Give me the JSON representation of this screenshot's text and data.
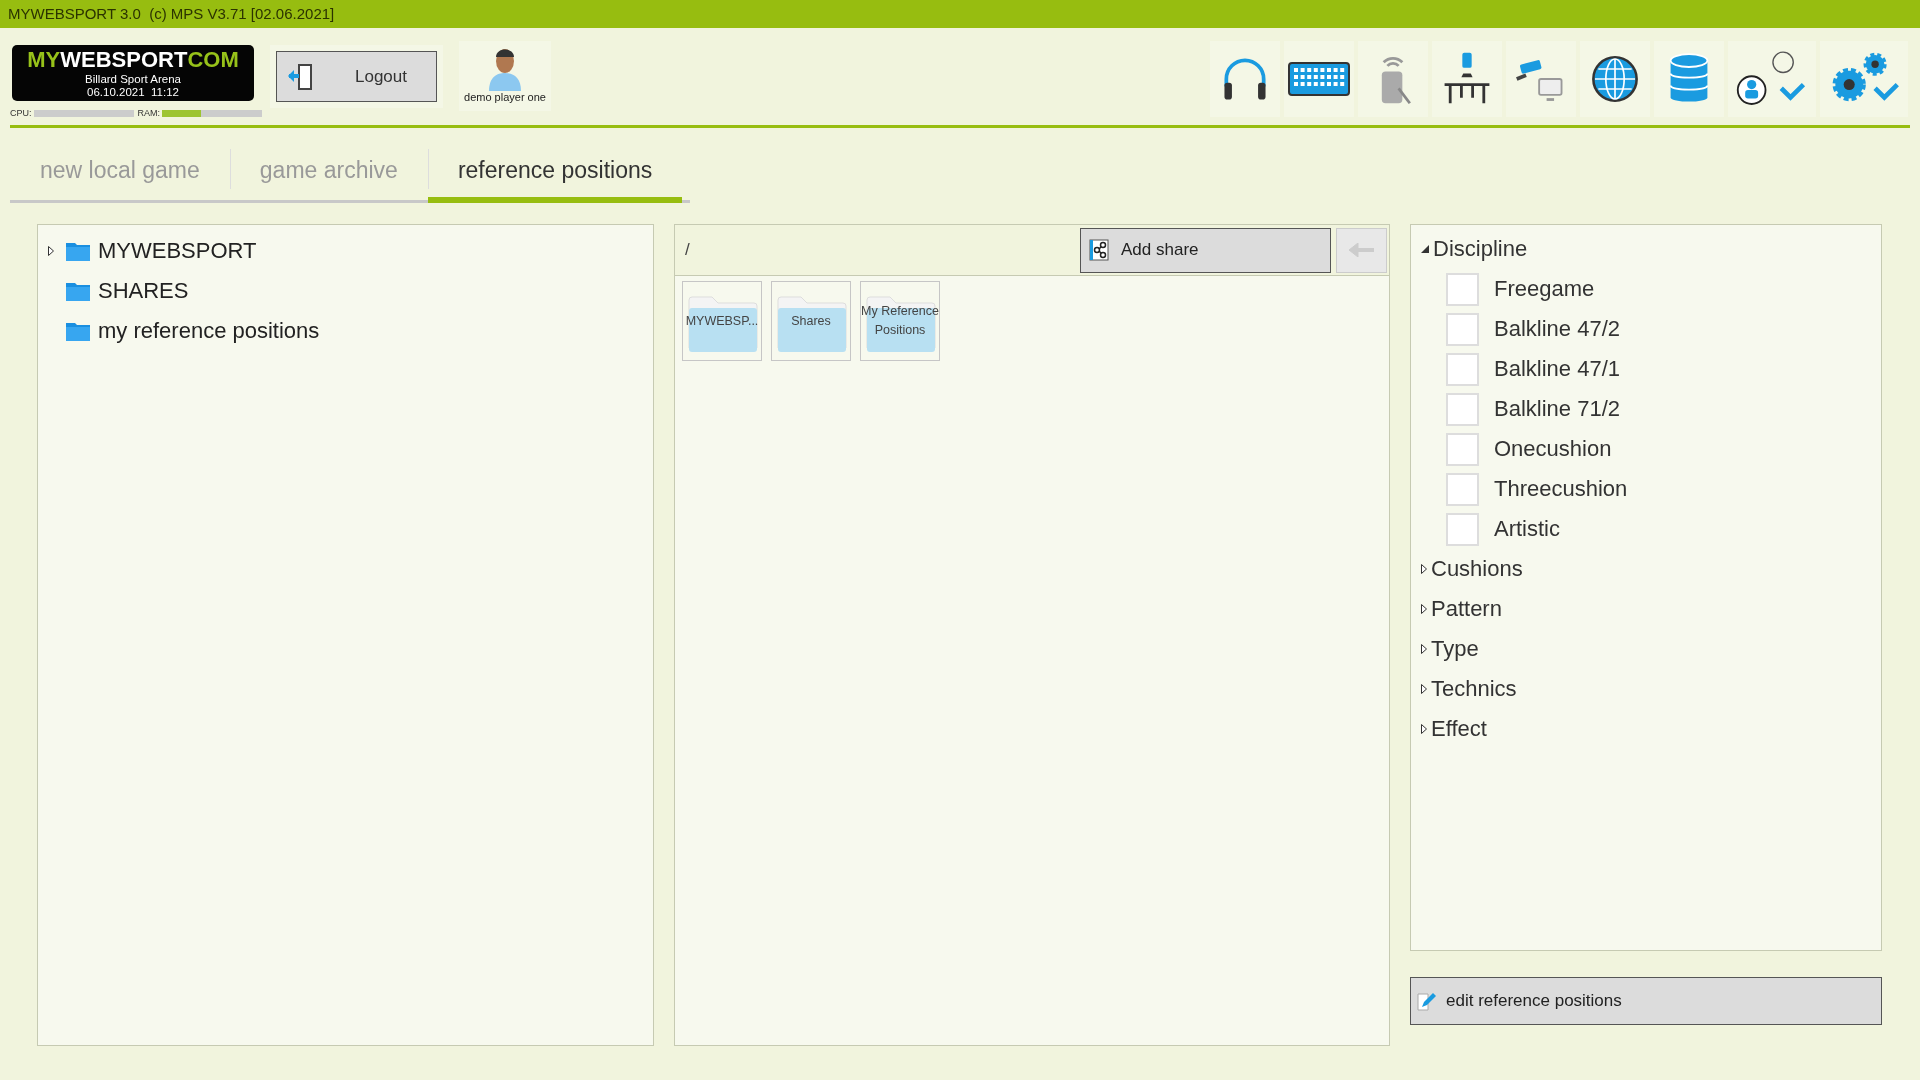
{
  "title_bar": {
    "title": "MYWEBSPORT 3.0  (c) MPS V3.71 [02.06.2021]"
  },
  "header": {
    "logo": {
      "part_1": "MY",
      "part_2": "WEBSPORT",
      "part_3": "COM",
      "subtitle": "Billard Sport Arena",
      "datetime": "06.10.2021  11:12"
    },
    "meters": [
      {
        "label": "CPU:",
        "level": 0
      },
      {
        "label": "RAM:",
        "level": 0.39
      }
    ],
    "logout_button": "Logout",
    "user": {
      "name": "demo player one"
    }
  },
  "tabs": [
    {
      "label": "new local game",
      "selected": false
    },
    {
      "label": "game archive",
      "selected": false
    },
    {
      "label": "reference positions",
      "selected": true
    }
  ],
  "tree": {
    "items": [
      {
        "label": "MYWEBSPORT",
        "kind": "expandable"
      },
      {
        "label": "SHARES",
        "kind": "leaf"
      },
      {
        "label": "my reference positions",
        "kind": "leaf"
      }
    ]
  },
  "browser": {
    "path": "/",
    "add_share_button": "Add share",
    "back_button": {
      "disabled": true
    },
    "folders": [
      {
        "label": "MYWEBSP..."
      },
      {
        "label": "Shares"
      },
      {
        "label": "My Reference Positions"
      }
    ]
  },
  "filters": {
    "groups": [
      {
        "label": "Discipline",
        "expanded": true,
        "options": [
          {
            "label": "Freegame",
            "checked": false
          },
          {
            "label": "Balkline 47/2",
            "checked": false
          },
          {
            "label": "Balkline 47/1",
            "checked": false
          },
          {
            "label": "Balkline 71/2",
            "checked": false
          },
          {
            "label": "Onecushion",
            "checked": false
          },
          {
            "label": "Threecushion",
            "checked": false
          },
          {
            "label": "Artistic",
            "checked": false
          }
        ]
      },
      {
        "label": "Cushions",
        "expanded": false
      },
      {
        "label": "Pattern",
        "expanded": false
      },
      {
        "label": "Type",
        "expanded": false
      },
      {
        "label": "Technics",
        "expanded": false
      },
      {
        "label": "Effect",
        "expanded": false
      }
    ]
  },
  "edit_button": "edit reference positions"
}
